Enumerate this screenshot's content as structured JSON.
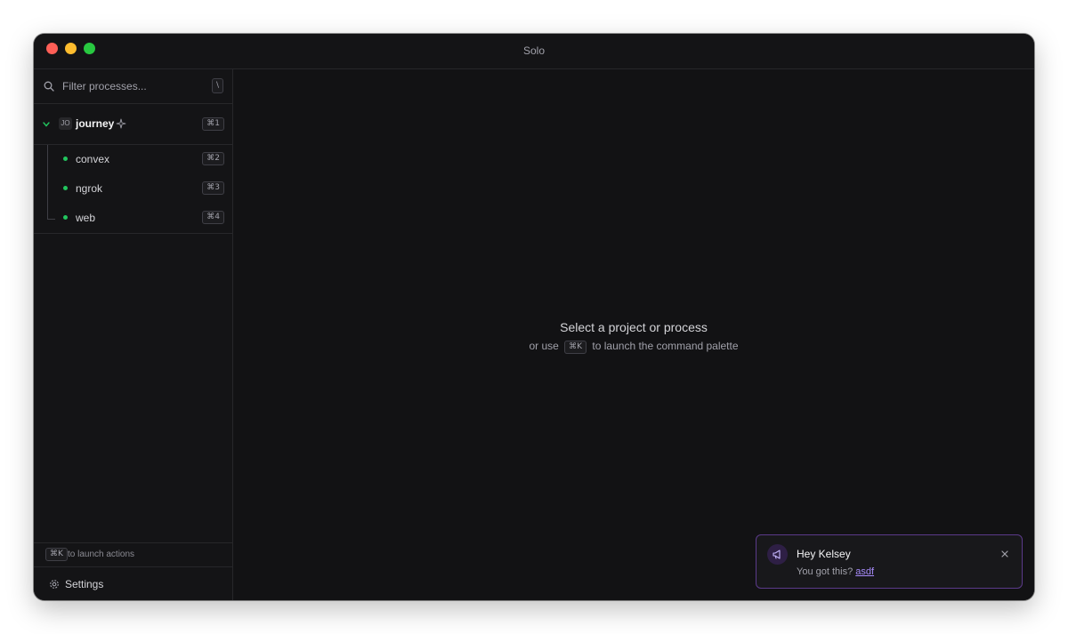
{
  "window": {
    "title": "Solo"
  },
  "sidebar": {
    "search": {
      "placeholder": "Filter processes...",
      "shortcut": "\\"
    },
    "project": {
      "badge": "JO",
      "name": "journey",
      "shortcut": "⌘1"
    },
    "processes": [
      {
        "name": "convex",
        "shortcut": "⌘2"
      },
      {
        "name": "ngrok",
        "shortcut": "⌘3"
      },
      {
        "name": "web",
        "shortcut": "⌘4"
      }
    ],
    "footer": {
      "shortcut": "⌘K",
      "text": "to launch actions"
    },
    "settings": {
      "label": "Settings"
    }
  },
  "main": {
    "empty_title": "Select a project or process",
    "empty_prefix": "or use",
    "empty_shortcut": "⌘K",
    "empty_suffix": "to launch the command palette"
  },
  "toast": {
    "title": "Hey Kelsey",
    "message": "You got this?",
    "link": "asdf"
  },
  "colors": {
    "background": "#121214",
    "status_green": "#22c55e",
    "accent_purple": "#a78bfa"
  }
}
